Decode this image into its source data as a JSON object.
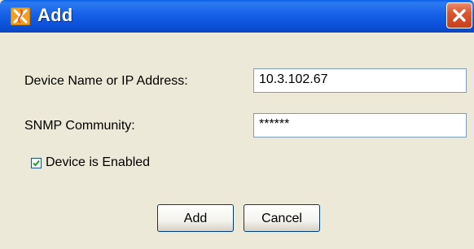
{
  "window": {
    "title": "Add"
  },
  "form": {
    "device_label": "Device Name or IP Address:",
    "device_value": "10.3.102.67",
    "snmp_label": "SNMP Community:",
    "snmp_value": "******",
    "enabled_label": "Device is Enabled",
    "enabled_checked": true
  },
  "buttons": {
    "add_label": "Add",
    "cancel_label": "Cancel"
  },
  "icons": {
    "app": "xirrus-app-icon",
    "close": "close-icon",
    "checkmark": "check-icon"
  },
  "colors": {
    "titlebar": "#0B50D8",
    "close": "#D9562E",
    "dialog_bg": "#ECE9D8",
    "app_icon": "#F0A020"
  }
}
